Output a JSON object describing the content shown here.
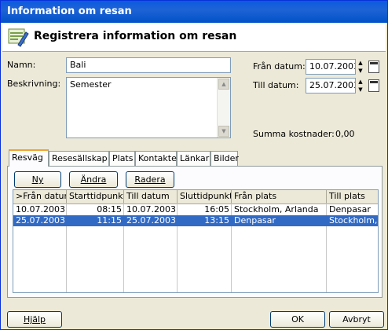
{
  "window": {
    "title": "Information om resan"
  },
  "header": {
    "title": "Registrera information om resan",
    "icon": "travel-edit-icon"
  },
  "form": {
    "name_label": "Namn:",
    "name_value": "Bali",
    "desc_label": "Beskrivning:",
    "desc_value": "Semester",
    "from_date_label": "Från datum:",
    "from_date_value": "10.07.2003",
    "to_date_label": "Till datum:",
    "to_date_value": "25.07.2003",
    "total_label": "Summa kostnader:",
    "total_value": "0,00"
  },
  "tabs": [
    {
      "label": "Resväg"
    },
    {
      "label": "Resesällskap"
    },
    {
      "label": "Plats"
    },
    {
      "label": "Kontakter"
    },
    {
      "label": "Länkar"
    },
    {
      "label": "Bilder"
    }
  ],
  "toolbar": {
    "new_label": "Ny",
    "edit_label": "Ändra",
    "delete_label": "Radera"
  },
  "grid": {
    "columns": [
      ">Från datum",
      "Starttidpunkt",
      "Till datum",
      "Sluttidpunkt",
      "Från plats",
      "Till plats"
    ],
    "rows": [
      [
        "10.07.2003",
        "08:15",
        "10.07.2003",
        "16:05",
        "Stockholm, Arlanda",
        "Denpasar"
      ],
      [
        "25.07.2003",
        "11:15",
        "25.07.2003",
        "13:15",
        "Denpasar",
        "Stockholm, Arla"
      ]
    ]
  },
  "footer": {
    "help_label": "Hjälp",
    "ok_label": "OK",
    "cancel_label": "Avbryt"
  }
}
